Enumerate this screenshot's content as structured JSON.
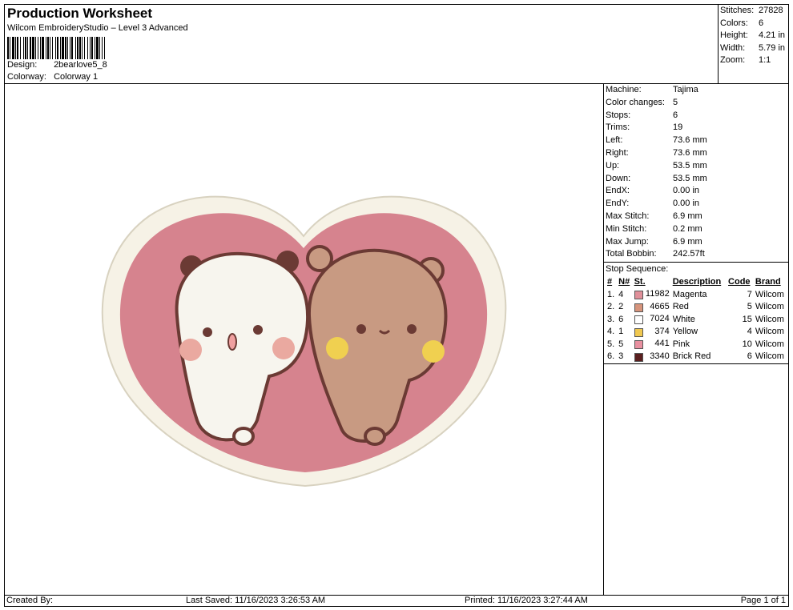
{
  "header": {
    "title": "Production Worksheet",
    "software": "Wilcom EmbroideryStudio – Level 3 Advanced",
    "design_label": "Design:",
    "design_value": "2bearlove5_8",
    "colorway_label": "Colorway:",
    "colorway_value": "Colorway 1"
  },
  "stats": [
    {
      "label": "Stitches:",
      "value": "27828"
    },
    {
      "label": "Colors:",
      "value": "6"
    },
    {
      "label": "Height:",
      "value": "4.21 in"
    },
    {
      "label": "Width:",
      "value": "5.79 in"
    },
    {
      "label": "Zoom:",
      "value": "1:1"
    }
  ],
  "params": [
    {
      "label": "Machine:",
      "value": "Tajima"
    },
    {
      "label": "Color changes:",
      "value": "5"
    },
    {
      "label": "Stops:",
      "value": "6"
    },
    {
      "label": "Trims:",
      "value": "19"
    },
    {
      "label": "Left:",
      "value": "73.6 mm"
    },
    {
      "label": "Right:",
      "value": "73.6 mm"
    },
    {
      "label": "Up:",
      "value": "53.5 mm"
    },
    {
      "label": "Down:",
      "value": "53.5 mm"
    },
    {
      "label": "EndX:",
      "value": "0.00 in"
    },
    {
      "label": "EndY:",
      "value": "0.00 in"
    },
    {
      "label": "Max Stitch:",
      "value": "6.9 mm"
    },
    {
      "label": "Min Stitch:",
      "value": "0.2 mm"
    },
    {
      "label": "Max Jump:",
      "value": "6.9 mm"
    },
    {
      "label": "Total Bobbin:",
      "value": "242.57ft"
    }
  ],
  "stop_sequence": {
    "title": "Stop Sequence:",
    "headers": [
      "#",
      "N#",
      "St.",
      "Description",
      "Code",
      "Brand"
    ],
    "rows": [
      {
        "num": "1.",
        "n": "4",
        "color": "#e0909a",
        "st": "11982",
        "desc": "Magenta",
        "code": "7",
        "brand": "Wilcom"
      },
      {
        "num": "2.",
        "n": "2",
        "color": "#d6947c",
        "st": "4665",
        "desc": "Red",
        "code": "5",
        "brand": "Wilcom"
      },
      {
        "num": "3.",
        "n": "6",
        "color": "#ffffff",
        "st": "7024",
        "desc": "White",
        "code": "15",
        "brand": "Wilcom"
      },
      {
        "num": "4.",
        "n": "1",
        "color": "#f0c850",
        "st": "374",
        "desc": "Yellow",
        "code": "4",
        "brand": "Wilcom"
      },
      {
        "num": "5.",
        "n": "5",
        "color": "#e890a0",
        "st": "441",
        "desc": "Pink",
        "code": "10",
        "brand": "Wilcom"
      },
      {
        "num": "6.",
        "n": "3",
        "color": "#5a1f1f",
        "st": "3340",
        "desc": "Brick Red",
        "code": "6",
        "brand": "Wilcom"
      }
    ]
  },
  "footer": {
    "created_by": "Created By:",
    "last_saved": "Last Saved: 11/16/2023 3:26:53 AM",
    "printed": "Printed: 11/16/2023 3:27:44 AM",
    "page": "Page 1 of 1"
  }
}
